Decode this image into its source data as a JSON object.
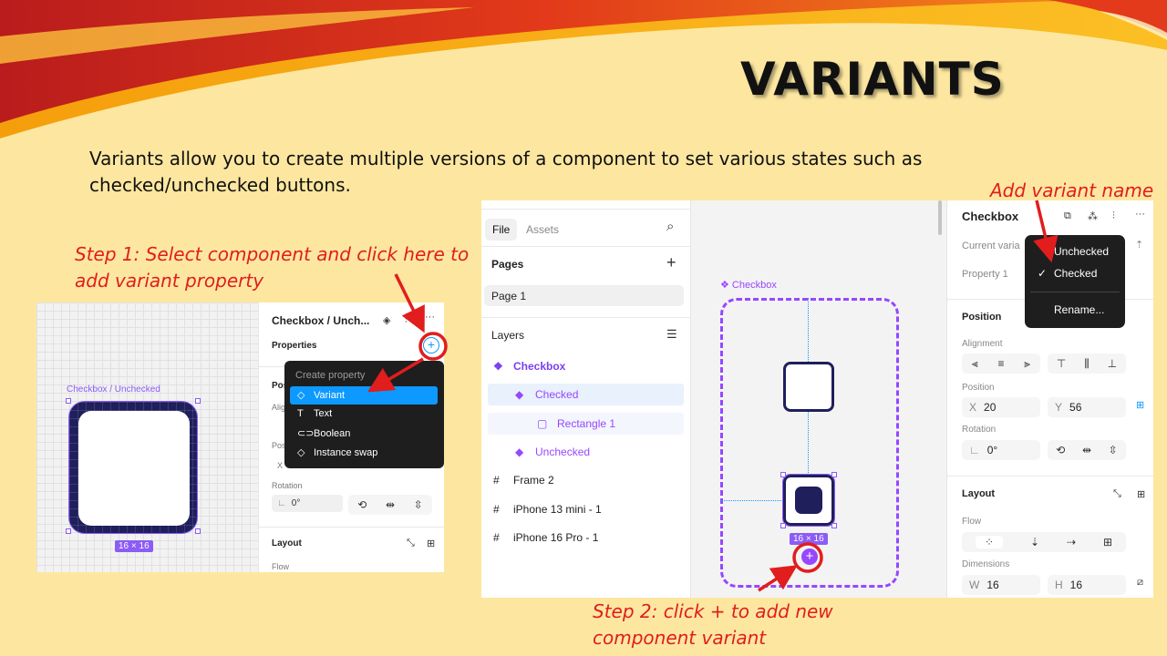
{
  "slide": {
    "title": "VARIANTS",
    "intro": "Variants allow you to create multiple versions of a component to set various states such as checked/unchecked buttons.",
    "step1": "Step 1: Select component and click here to add variant property",
    "step2": "Step 2: click + to add new component variant",
    "add_variant_name": "Add variant name"
  },
  "shot1": {
    "canvas": {
      "component_label": "Checkbox / Unchecked",
      "size_badge": "16 × 16"
    },
    "panel": {
      "title": "Checkbox / Unch...",
      "properties_label": "Properties",
      "add_property": "+",
      "rotation_label": "Rotation",
      "rotation_value": "0°",
      "layout_label": "Layout",
      "flow_label": "Flow",
      "hidden_labels": [
        "Pos",
        "Alig",
        "Pos",
        "X"
      ]
    },
    "menu": {
      "header": "Create property",
      "items": [
        {
          "label": "Variant",
          "icon": "◇"
        },
        {
          "label": "Text",
          "icon": "T"
        },
        {
          "label": "Boolean",
          "icon": "⊂⊃"
        },
        {
          "label": "Instance swap",
          "icon": "◇"
        }
      ]
    }
  },
  "shot2": {
    "tabs": [
      "File",
      "Assets"
    ],
    "pages_label": "Pages",
    "pages": [
      "Page 1"
    ],
    "layers_label": "Layers",
    "layers": [
      {
        "label": "Checkbox",
        "icon": "❖",
        "indent": 0,
        "color": "#7b3ff2",
        "bold": true,
        "selected": false
      },
      {
        "label": "Checked",
        "icon": "◆",
        "indent": 1,
        "color": "#9747ff",
        "bold": false,
        "selected": true
      },
      {
        "label": "Rectangle 1",
        "icon": "▢",
        "indent": 2,
        "color": "#9747ff",
        "bold": false,
        "selected": true
      },
      {
        "label": "Unchecked",
        "icon": "◆",
        "indent": 1,
        "color": "#9747ff",
        "bold": false,
        "selected": false
      },
      {
        "label": "Frame 2",
        "icon": "#",
        "indent": 0,
        "color": "#222222",
        "bold": false,
        "selected": false
      },
      {
        "label": "iPhone 13 mini - 1",
        "icon": "#",
        "indent": 0,
        "color": "#222222",
        "bold": false,
        "selected": false
      },
      {
        "label": "iPhone 16 Pro - 1",
        "icon": "#",
        "indent": 0,
        "color": "#222222",
        "bold": false,
        "selected": false
      }
    ],
    "canvas": {
      "component_set_label": "❖ Checkbox",
      "size_badge": "16 × 16",
      "add_variant": "+"
    },
    "properties": {
      "title": "Checkbox",
      "current_variant_label": "Current varia",
      "property1_label": "Property 1",
      "position_section": "Position",
      "alignment_label": "Alignment",
      "position_label": "Position",
      "x_label": "X",
      "x_value": "20",
      "y_label": "Y",
      "y_value": "56",
      "rotation_label": "Rotation",
      "rotation_value": "0°",
      "layout_section": "Layout",
      "flow_label": "Flow",
      "dimensions_label": "Dimensions",
      "w_label": "W",
      "w_value": "16",
      "h_label": "H",
      "h_value": "16"
    },
    "variant_menu": {
      "items": [
        "Unchecked",
        "Checked"
      ],
      "checked_item": "Checked",
      "rename": "Rename..."
    }
  },
  "colors": {
    "background": "#fde7a0",
    "annotation_red": "#e11d1d",
    "figma_purple": "#9747ff",
    "figma_blue": "#0d99ff",
    "checkbox_navy": "#1f1f5c"
  }
}
